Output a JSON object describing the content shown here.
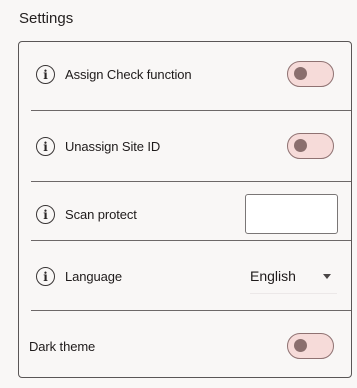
{
  "page": {
    "title": "Settings"
  },
  "settings": {
    "assign_check": {
      "label": "Assign Check function",
      "info_icon": "info-icon",
      "enabled": false
    },
    "unassign_site": {
      "label": "Unassign Site ID",
      "info_icon": "info-icon",
      "enabled": false
    },
    "scan_protect": {
      "label": "Scan protect",
      "info_icon": "info-icon",
      "value": ""
    },
    "language": {
      "label": "Language",
      "info_icon": "info-icon",
      "selected": "English",
      "dropdown_icon": "chevron-down-icon"
    },
    "dark_theme": {
      "label": "Dark theme",
      "enabled": false
    }
  },
  "colors": {
    "background": "#f9f7f6",
    "toggle_track": "#f6dbd9",
    "toggle_border": "#8f7272",
    "toggle_knob": "#8a6f6e",
    "border": "#5a5656"
  }
}
